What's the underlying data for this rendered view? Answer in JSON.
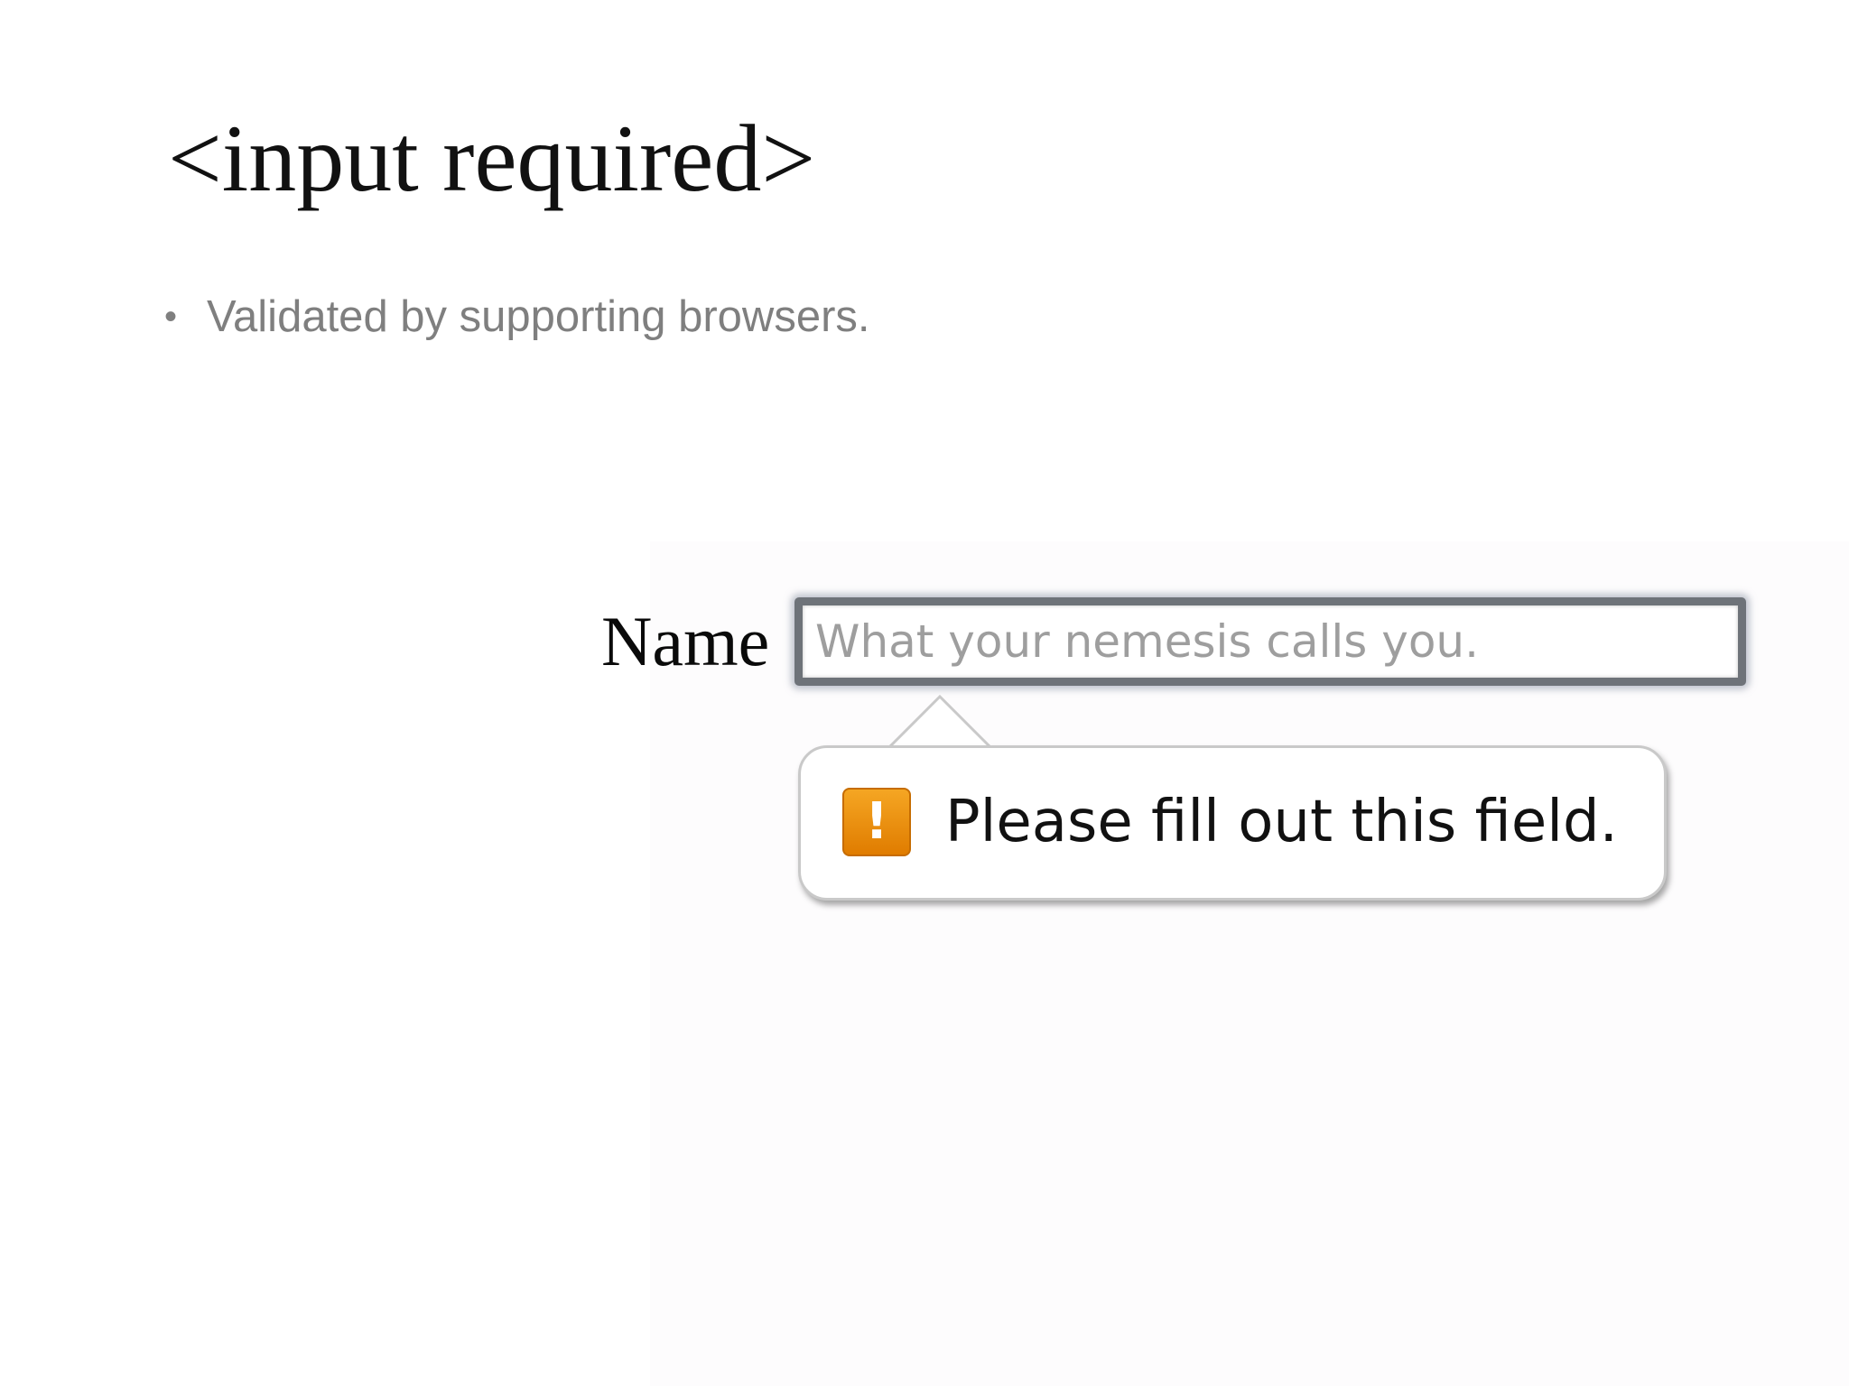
{
  "slide": {
    "title": "<input required>",
    "bullets": [
      {
        "marker": "•",
        "text": "Validated by supporting browsers."
      }
    ]
  },
  "form": {
    "label": "Name",
    "input_placeholder": "What your nemesis calls you.",
    "input_value": ""
  },
  "validation_tooltip": {
    "icon": "warning-icon",
    "icon_glyph": "!",
    "message": "Please fill out this field.",
    "icon_color": "#f39c12"
  }
}
